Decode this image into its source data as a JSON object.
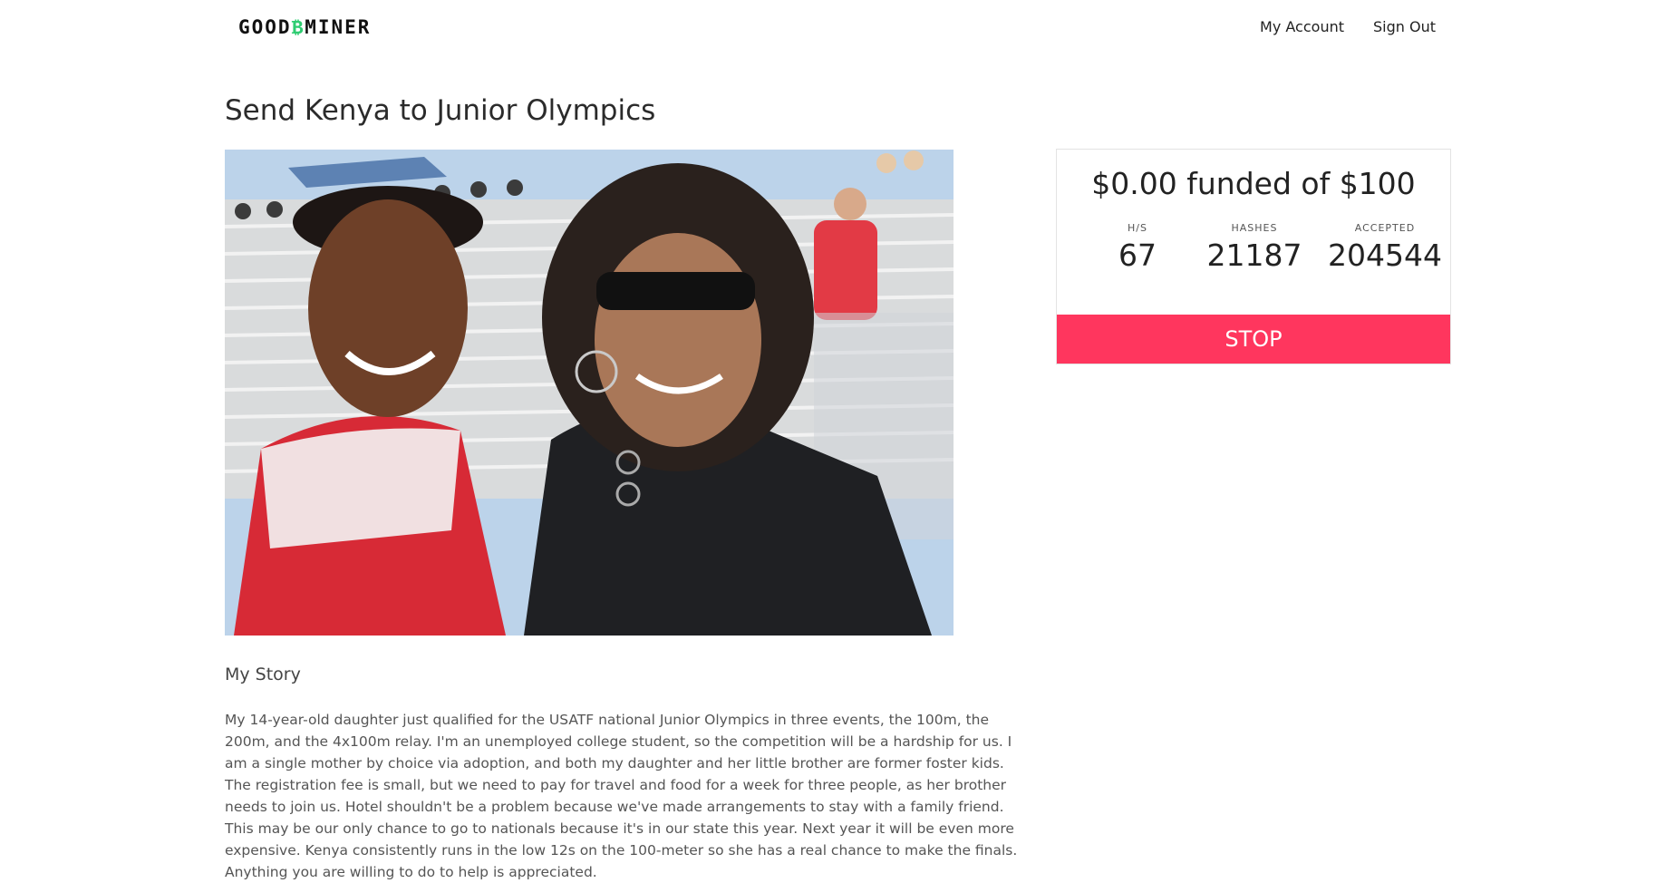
{
  "nav": {
    "logo_prefix": "GOOD",
    "logo_symbol": "₿",
    "logo_suffix": "MINER",
    "links": [
      "My Account",
      "Sign Out"
    ]
  },
  "campaign": {
    "title": "Send Kenya to Junior Olympics",
    "photo_icon": "photo-of-daughter-and-mother-at-track-meet",
    "story_heading": "My Story",
    "story_text": "My 14-year-old daughter just qualified for the USATF national Junior Olympics in three events, the 100m, the 200m, and the 4x100m relay. I'm an unemployed college student, so the competition will be a hardship for us. I am a single mother by choice via adoption, and both my daughter and her little brother are former foster kids. The registration fee is small, but we need to pay for travel and food for a week for three people, as her brother needs to join us. Hotel shouldn't be a problem because we've made arrangements to stay with a family friend. This may be our only chance to go to nationals because it's in our state this year. Next year it will be even more expensive. Kenya consistently runs in the low 12s on the 100-meter so she has a real chance to make the finals. Anything you are willing to do to help is appreciated."
  },
  "funding": {
    "funded_text": "$0.00 funded of $100",
    "stats": [
      {
        "label": "H/S",
        "value": "67"
      },
      {
        "label": "HASHES",
        "value": "21187"
      },
      {
        "label": "ACCEPTED",
        "value": "204544"
      }
    ],
    "button_label": "STOP",
    "button_color": "#ff365e",
    "logo_accent": "#2ecc71"
  }
}
